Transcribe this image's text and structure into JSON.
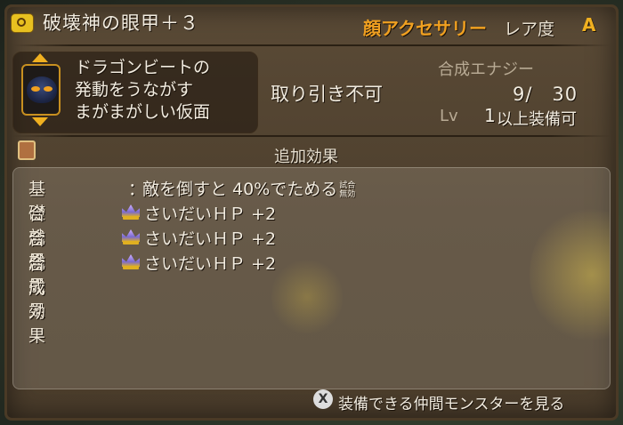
{
  "item": {
    "name": "破壊神の眼甲＋３",
    "category": "顔アクセサリー",
    "rarity_label": "レア度",
    "rarity_value": "A",
    "icon": "mask-icon",
    "description": [
      "ドラゴンビートの",
      "発動をうながす",
      "まがまがしい仮面"
    ],
    "tradable": "取り引き不可",
    "energy_label": "合成エナジー",
    "energy_value": "9/　30",
    "energy_current": 9,
    "energy_max": 30,
    "level_label": "Lv",
    "level_value": "1",
    "level_suffix": "以上装備可"
  },
  "effects": {
    "section_title": "追加効果",
    "base": {
      "label": "基礎効果",
      "separator": "：",
      "text": "敵を倒すと 40%でためる",
      "badge": [
        "試合",
        "無効"
      ]
    },
    "synth": [
      {
        "label": "合成効果",
        "icon": "crown-icon",
        "text": "さいだいＨＰ +2"
      },
      {
        "label": "合成効果",
        "icon": "crown-icon",
        "text": "さいだいＨＰ +2"
      },
      {
        "label": "合成効果",
        "icon": "crown-icon",
        "text": "さいだいＨＰ +2"
      }
    ]
  },
  "footer": {
    "button_glyph": "X",
    "text": "装備できる仲間モンスターを見る"
  },
  "colors": {
    "panel": "#4e402e",
    "accent_orange": "#f0a020",
    "text": "#f2ece0"
  }
}
